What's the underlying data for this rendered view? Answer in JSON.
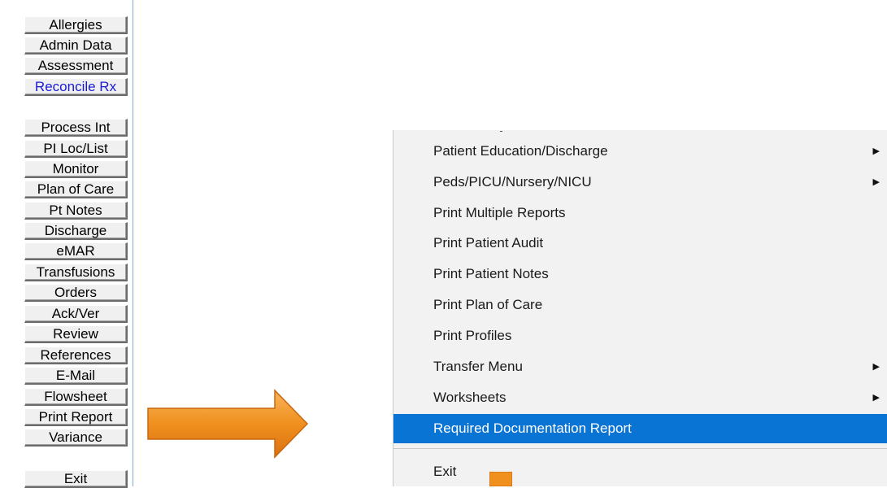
{
  "panel": {
    "buttons": [
      {
        "label": "Allergies"
      },
      {
        "label": "Admin Data"
      },
      {
        "label": "Assessment"
      },
      {
        "label": "Reconcile Rx"
      },
      {
        "label": "Process Int"
      },
      {
        "label": "PI Loc/List"
      },
      {
        "label": "Monitor"
      },
      {
        "label": "Plan of Care"
      },
      {
        "label": "Pt Notes"
      },
      {
        "label": "Discharge"
      },
      {
        "label": "eMAR"
      },
      {
        "label": "Transfusions"
      },
      {
        "label": "Orders"
      },
      {
        "label": "Ack/Ver"
      },
      {
        "label": "Review"
      },
      {
        "label": "References"
      },
      {
        "label": "E-Mail"
      },
      {
        "label": "Flowsheet"
      },
      {
        "label": "Print Report"
      },
      {
        "label": "Variance"
      },
      {
        "label": "Exit"
      }
    ],
    "link_color": "#1a1ad8"
  },
  "arrow": {
    "color": "#f0901e"
  },
  "menu": {
    "items": [
      {
        "label": "Patient Education/Discharge",
        "submenu": true
      },
      {
        "label": "Peds/PICU/Nursery/NICU",
        "submenu": true
      },
      {
        "label": "Print Multiple Reports",
        "submenu": false
      },
      {
        "label": "Print Patient Audit",
        "submenu": false
      },
      {
        "label": "Print Patient Notes",
        "submenu": false
      },
      {
        "label": "Print Plan of Care",
        "submenu": false
      },
      {
        "label": "Print Profiles",
        "submenu": false
      },
      {
        "label": "Transfer Menu",
        "submenu": true
      },
      {
        "label": "Worksheets",
        "submenu": true
      },
      {
        "label": "Required Documentation Report",
        "submenu": false,
        "highlighted": true
      },
      {
        "label": "Exit",
        "submenu": false
      }
    ],
    "submenu_glyph": "▶",
    "highlight_color": "#0a74d4"
  }
}
